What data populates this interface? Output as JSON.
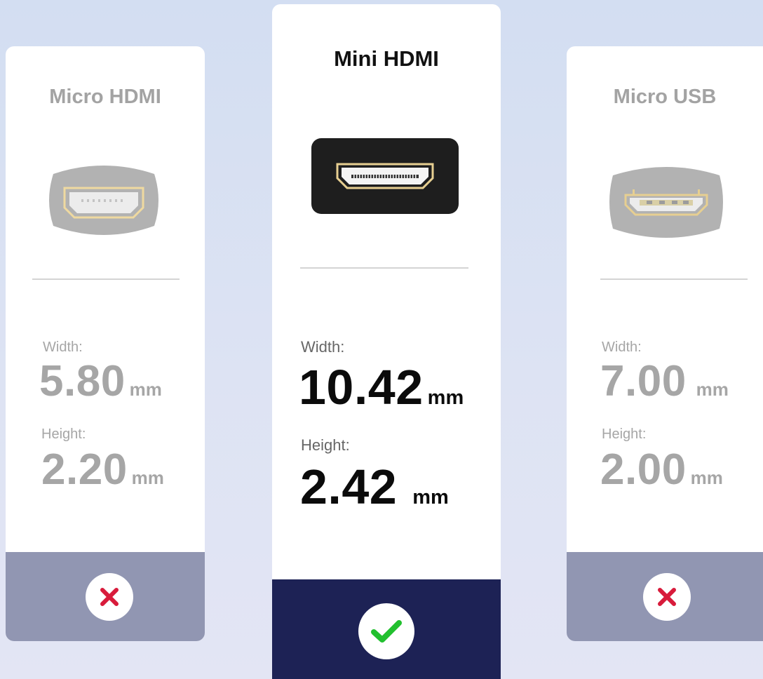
{
  "cards": [
    {
      "title": "Micro HDMI",
      "width_label": "Width:",
      "width_value": "5.80",
      "height_label": "Height:",
      "height_value": "2.20",
      "unit": "mm",
      "status": "incompatible",
      "status_icon": "cross-icon"
    },
    {
      "title": "Mini HDMI",
      "width_label": "Width:",
      "width_value": "10.42",
      "height_label": "Height:",
      "height_value": "2.42",
      "unit": "mm",
      "status": "compatible",
      "status_icon": "check-icon"
    },
    {
      "title": "Micro USB",
      "width_label": "Width:",
      "width_value": "7.00",
      "height_label": "Height:",
      "height_value": "2.00",
      "unit": "mm",
      "status": "incompatible",
      "status_icon": "cross-icon"
    }
  ],
  "colors": {
    "background": "#d8e1f3",
    "card": "#ffffff",
    "muted_text": "#a6a6a6",
    "highlight_text": "#0b0b0b",
    "muted_footer": "#9196b2",
    "highlight_footer": "#1d2255",
    "cross": "#d81b3b",
    "check": "#22c02f",
    "connector_gold": "#e7cf91"
  }
}
